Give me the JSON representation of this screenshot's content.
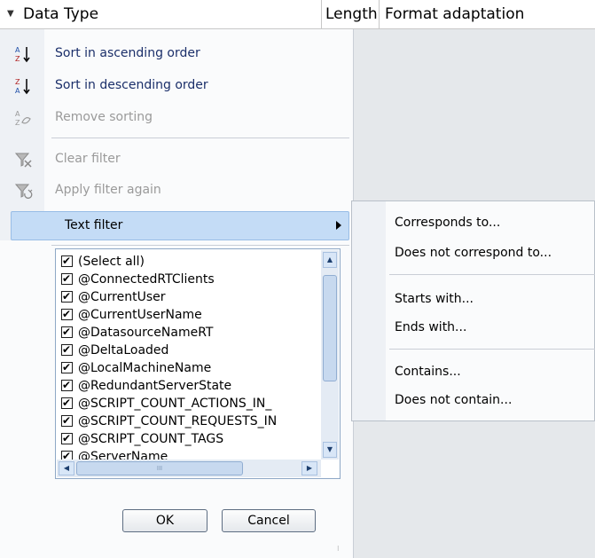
{
  "header": {
    "col1": "Data Type",
    "col2": "Length",
    "col3": "Format adaptation"
  },
  "menu": {
    "sort_asc": "Sort in ascending order",
    "sort_desc": "Sort in descending order",
    "remove_sort": "Remove sorting",
    "clear_filter": "Clear filter",
    "apply_filter": "Apply filter again",
    "text_filter": "Text filter"
  },
  "values": [
    "(Select all)",
    "@ConnectedRTClients",
    "@CurrentUser",
    "@CurrentUserName",
    "@DatasourceNameRT",
    "@DeltaLoaded",
    "@LocalMachineName",
    "@RedundantServerState",
    "@SCRIPT_COUNT_ACTIONS_IN_",
    "@SCRIPT_COUNT_REQUESTS_IN",
    "@SCRIPT_COUNT_TAGS",
    "@ServerName"
  ],
  "buttons": {
    "ok": "OK",
    "cancel": "Cancel"
  },
  "submenu": {
    "corresponds": "Corresponds to...",
    "not_corresponds": "Does not correspond to...",
    "starts": "Starts with...",
    "ends": "Ends with...",
    "contains": "Contains...",
    "not_contains": "Does not contain..."
  }
}
